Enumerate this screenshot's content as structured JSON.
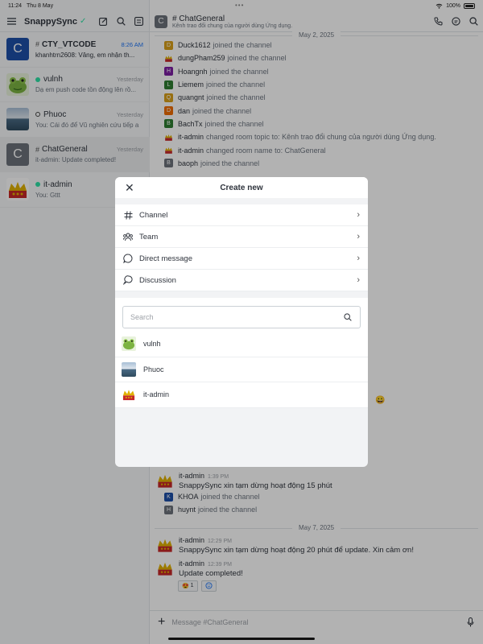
{
  "status_bar": {
    "time": "11:24",
    "date": "Thu 8 May",
    "battery": "100%"
  },
  "sidebar": {
    "title": "SnappySync",
    "rooms": [
      {
        "name": "CTY_VTCODE",
        "type": "channel",
        "time": "8:26 AM",
        "preview": "khanhtrn2608: Vâng, em nhận th...",
        "unread": true,
        "avatar_letter": "C",
        "avatar_color": "#1d4fa8"
      },
      {
        "name": "vulnh",
        "type": "dm-online",
        "time": "Yesterday",
        "preview": "Dạ em push code tồn động lên rồ...",
        "avatar_letter": "",
        "avatar_color": "#7cb342"
      },
      {
        "name": "Phuoc",
        "type": "dm-offline",
        "time": "Yesterday",
        "preview": "You: Cái đó để Vũ nghiên cứu tiếp a",
        "avatar_letter": "",
        "avatar_color": "#5b7a99"
      },
      {
        "name": "ChatGeneral",
        "type": "channel",
        "time": "Yesterday",
        "preview": "it-admin: Update completed!",
        "avatar_letter": "C",
        "avatar_color": "#6c727a"
      },
      {
        "name": "it-admin",
        "type": "dm-online",
        "time": "",
        "preview": "You: Gttt",
        "avatar_letter": "",
        "avatar_color": "#c62828"
      }
    ]
  },
  "chat": {
    "room_name": "ChatGeneral",
    "topic": "Kênh trao đổi chung của người dùng Ứng dụng.",
    "day1": "May 2, 2025",
    "system_messages": [
      {
        "user": "Duck1612",
        "text": "joined the channel",
        "letter": "D",
        "color": "#d9a019"
      },
      {
        "user": "dungPham259",
        "text": "joined the channel",
        "letter": "",
        "color": "#c62828"
      },
      {
        "user": "Hoangnh",
        "text": "joined the channel",
        "letter": "H",
        "color": "#7b1fa2"
      },
      {
        "user": "Liemem",
        "text": "joined the channel",
        "letter": "L",
        "color": "#2e7d32"
      },
      {
        "user": "quangnt",
        "text": "joined the channel",
        "letter": "Q",
        "color": "#d9a019"
      },
      {
        "user": "dan",
        "text": "joined the channel",
        "letter": "D",
        "color": "#ef6c00"
      },
      {
        "user": "BachTx",
        "text": "joined the channel",
        "letter": "B",
        "color": "#2e7d32"
      },
      {
        "user": "it-admin",
        "text": "changed room topic to: Kênh trao đổi chung của người dùng Ứng dụng.",
        "letter": "",
        "color": "#c62828"
      },
      {
        "user": "it-admin",
        "text": "changed room name to: ChatGeneral",
        "letter": "",
        "color": "#c62828"
      },
      {
        "user": "baoph",
        "text": "joined the channel",
        "letter": "B",
        "color": "#6c727a"
      }
    ],
    "msg1": {
      "user": "it-admin",
      "time": "1:39 PM",
      "text": "SnappySync xin tạm dừng hoạt động 15 phút"
    },
    "system_messages_2": [
      {
        "user": "KHOA",
        "text": "joined the channel",
        "letter": "K",
        "color": "#1d4fa8"
      },
      {
        "user": "huynt",
        "text": "joined the channel",
        "letter": "H",
        "color": "#6c727a"
      }
    ],
    "day2": "May 7, 2025",
    "msg2": {
      "user": "it-admin",
      "time": "12:29 PM",
      "text": "SnappySync xin tạm dừng hoạt động 20 phút để update. Xin cảm ơn!"
    },
    "msg3": {
      "user": "it-admin",
      "time": "12:39 PM",
      "text": "Update completed!"
    },
    "reaction": {
      "emoji": "😍",
      "count": "1"
    },
    "composer_placeholder": "Message #ChatGeneral",
    "partial_emoji": "😀"
  },
  "modal": {
    "title": "Create new",
    "options": [
      {
        "label": "Channel",
        "icon": "hash-icon"
      },
      {
        "label": "Team",
        "icon": "team-icon"
      },
      {
        "label": "Direct message",
        "icon": "direct-message-icon"
      },
      {
        "label": "Discussion",
        "icon": "discussion-icon"
      }
    ],
    "search_placeholder": "Search",
    "users": [
      {
        "name": "vulnh",
        "avatar": "frog"
      },
      {
        "name": "Phuoc",
        "avatar": "photo"
      },
      {
        "name": "it-admin",
        "avatar": "crown"
      }
    ]
  }
}
